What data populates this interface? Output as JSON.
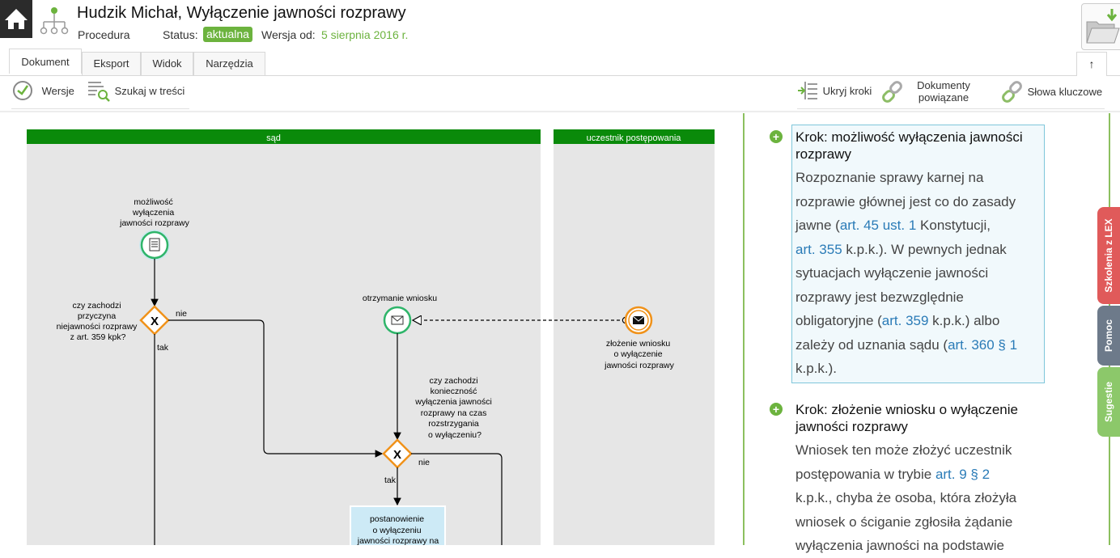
{
  "header": {
    "title": "Hudzik Michał, Wyłączenie jawności rozprawy",
    "procedure_label": "Procedura",
    "status_label": "Status:",
    "status_value": "aktualna",
    "version_label": "Wersja od:",
    "version_date": "5 sierpnia 2016 r."
  },
  "tabs": [
    {
      "label": "Dokument",
      "active": true
    },
    {
      "label": "Eksport"
    },
    {
      "label": "Widok"
    },
    {
      "label": "Narzędzia"
    }
  ],
  "toolbar": {
    "versions": "Wersje",
    "search": "Szukaj w treści",
    "hide_steps": "Ukryj kroki",
    "related_docs_line1": "Dokumenty",
    "related_docs_line2": "powiązane",
    "keywords": "Słowa kluczowe"
  },
  "diagram": {
    "lanes": [
      "sąd",
      "uczestnik postępowania"
    ],
    "nodes": {
      "start1": [
        "możliwość",
        "wyłączenia",
        "jawności rozprawy"
      ],
      "gw1_question": [
        "czy zachodzi",
        "przyczyna",
        "niejawności rozprawy",
        "z art. 359 kpk?"
      ],
      "gw1_no": "nie",
      "gw1_yes": "tak",
      "receive": "otrzymanie wniosku",
      "send": [
        "złożenie wniosku",
        "o wyłączenie",
        "jawności rozprawy"
      ],
      "gw2_question": [
        "czy zachodzi",
        "konieczność",
        "wyłączenia jawności",
        "rozprawy na czas",
        "rozstrzygania",
        "o wyłączeniu?"
      ],
      "gw2_no": "nie",
      "gw2_yes": "tak",
      "task": [
        "postanowienie",
        "o wyłączeniu",
        "jawności rozprawy na"
      ]
    }
  },
  "steps": [
    {
      "title": [
        "Krok: możliwość wyłączenia jawności",
        "rozprawy"
      ],
      "lines": [
        [
          {
            "t": "Rozpoznanie sprawy karnej na"
          }
        ],
        [
          {
            "t": "rozprawie głównej jest co do zasady"
          }
        ],
        [
          {
            "t": "jawne ("
          },
          {
            "a": "art. 45 ust. 1"
          },
          {
            "t": " Konstytucji,"
          }
        ],
        [
          {
            "a": "art. 355"
          },
          {
            "t": " k.p.k.). W pewnych jednak"
          }
        ],
        [
          {
            "t": "sytuacjach wyłączenie jawności"
          }
        ],
        [
          {
            "t": "rozprawy jest bezwzględnie"
          }
        ],
        [
          {
            "t": "obligatoryjne ("
          },
          {
            "a": "art. 359"
          },
          {
            "t": " k.p.k.) albo"
          }
        ],
        [
          {
            "t": "zależy od uznania sądu ("
          },
          {
            "a": "art. 360 § 1"
          }
        ],
        [
          {
            "t": "k.p.k.)."
          }
        ]
      ]
    },
    {
      "title": [
        "Krok: złożenie wniosku o wyłączenie",
        "jawności rozprawy"
      ],
      "lines": [
        [
          {
            "t": "Wniosek ten może złożyć uczestnik"
          }
        ],
        [
          {
            "t": "postępowania w trybie "
          },
          {
            "a": "art. 9 § 2"
          }
        ],
        [
          {
            "t": "k.p.k., chyba że osoba, która złożyła"
          }
        ],
        [
          {
            "t": "wniosek o ściganie zgłosiła żądanie"
          }
        ],
        [
          {
            "t": "wyłączenia jawności na podstawie"
          }
        ]
      ]
    }
  ],
  "side_tabs": [
    "Szkolenia z LEX",
    "Pomoc",
    "Sugestie"
  ],
  "colors": {
    "accent": "#6cb33e",
    "link": "#2a7bb7",
    "lane_header": "#0a8a0a",
    "gateway": "#f0921a",
    "side_red": "#e05a5a",
    "side_gray": "#6d7a8a",
    "side_green": "#8cc86a"
  }
}
